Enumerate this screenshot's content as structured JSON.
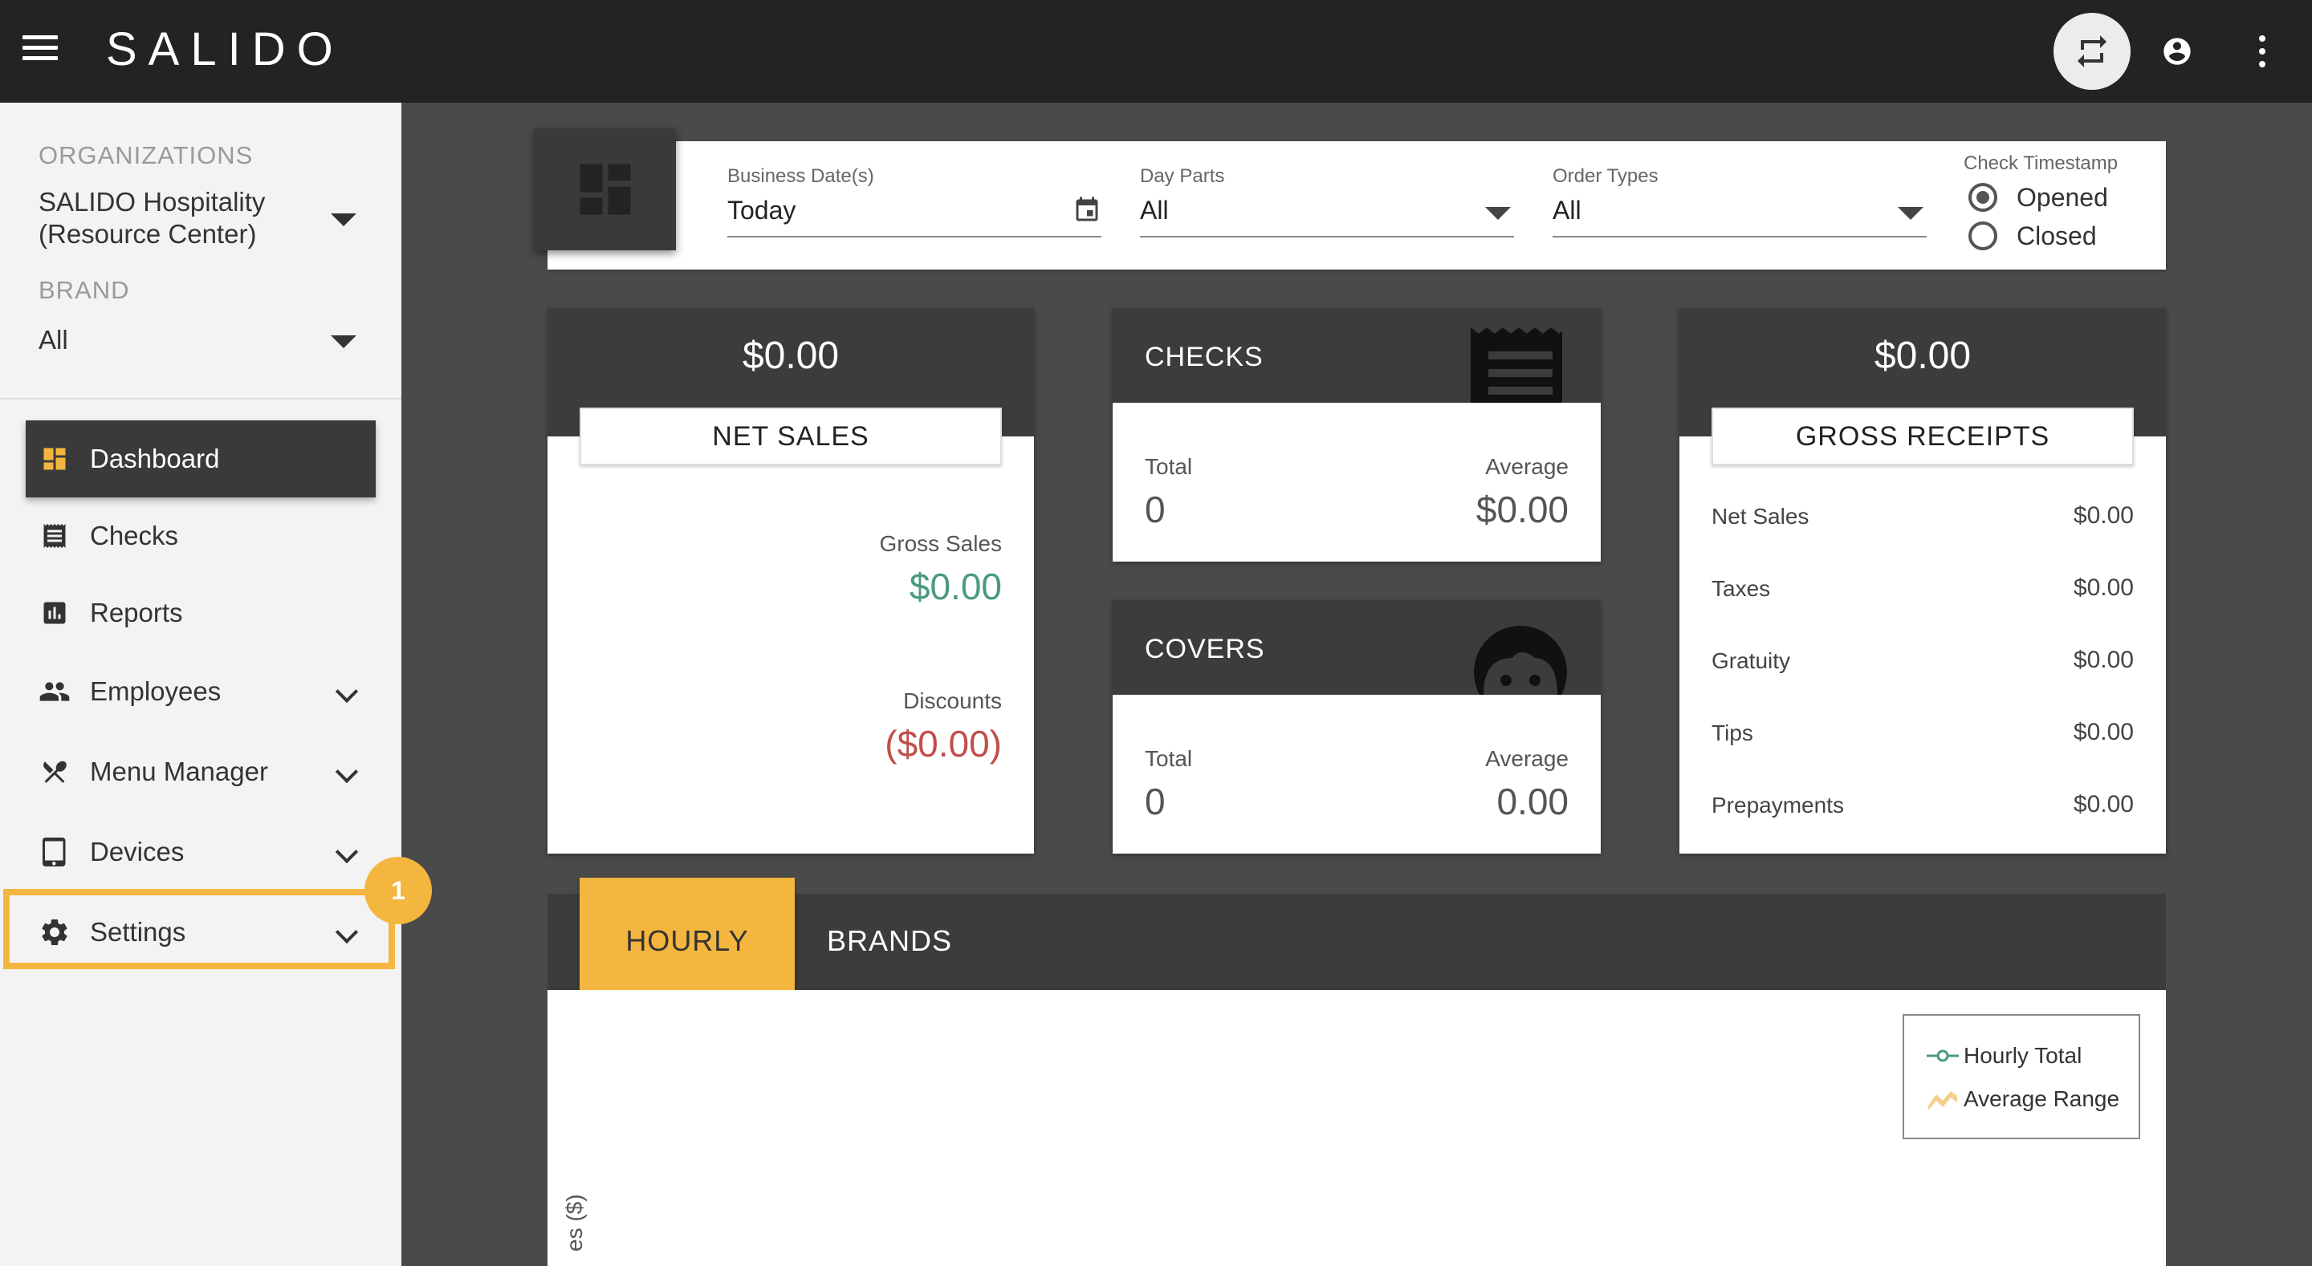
{
  "header": {
    "logo": "SALIDO"
  },
  "sidebar": {
    "org_label": "ORGANIZATIONS",
    "org_value_line1": "SALIDO Hospitality",
    "org_value_line2": "(Resource Center)",
    "brand_label": "BRAND",
    "brand_value": "All",
    "items": [
      {
        "label": "Dashboard",
        "icon": "dashboard-icon"
      },
      {
        "label": "Checks",
        "icon": "receipt-icon"
      },
      {
        "label": "Reports",
        "icon": "bar-chart-icon"
      },
      {
        "label": "Employees",
        "icon": "people-icon"
      },
      {
        "label": "Menu Manager",
        "icon": "utensils-icon"
      },
      {
        "label": "Devices",
        "icon": "tablet-icon"
      },
      {
        "label": "Settings",
        "icon": "gear-icon"
      }
    ],
    "step_badge": "1"
  },
  "filters": {
    "business_date_label": "Business Date(s)",
    "business_date_value": "Today",
    "day_parts_label": "Day Parts",
    "day_parts_value": "All",
    "order_types_label": "Order Types",
    "order_types_value": "All",
    "check_timestamp_label": "Check Timestamp",
    "opened_label": "Opened",
    "closed_label": "Closed",
    "selected_timestamp": "Opened"
  },
  "net_sales": {
    "amount": "$0.00",
    "title": "NET SALES",
    "gross_sales_label": "Gross Sales",
    "gross_sales_value": "$0.00",
    "discounts_label": "Discounts",
    "discounts_value": "($0.00)"
  },
  "checks": {
    "title": "CHECKS",
    "total_label": "Total",
    "total_value": "0",
    "average_label": "Average",
    "average_value": "$0.00"
  },
  "covers": {
    "title": "COVERS",
    "total_label": "Total",
    "total_value": "0",
    "average_label": "Average",
    "average_value": "0.00"
  },
  "gross_receipts": {
    "amount": "$0.00",
    "title": "GROSS RECEIPTS",
    "rows": [
      {
        "label": "Net Sales",
        "value": "$0.00"
      },
      {
        "label": "Taxes",
        "value": "$0.00"
      },
      {
        "label": "Gratuity",
        "value": "$0.00"
      },
      {
        "label": "Tips",
        "value": "$0.00"
      },
      {
        "label": "Prepayments",
        "value": "$0.00"
      }
    ]
  },
  "chart": {
    "tabs": [
      "HOURLY",
      "BRANDS"
    ],
    "active_tab": "HOURLY",
    "legend": [
      "Hourly Total",
      "Average Range"
    ],
    "y_label_fragment": "es ($)"
  },
  "colors": {
    "accent": "#f4b63f",
    "topbar": "#232323",
    "positive": "#4a9a80",
    "negative": "#c0504d"
  }
}
